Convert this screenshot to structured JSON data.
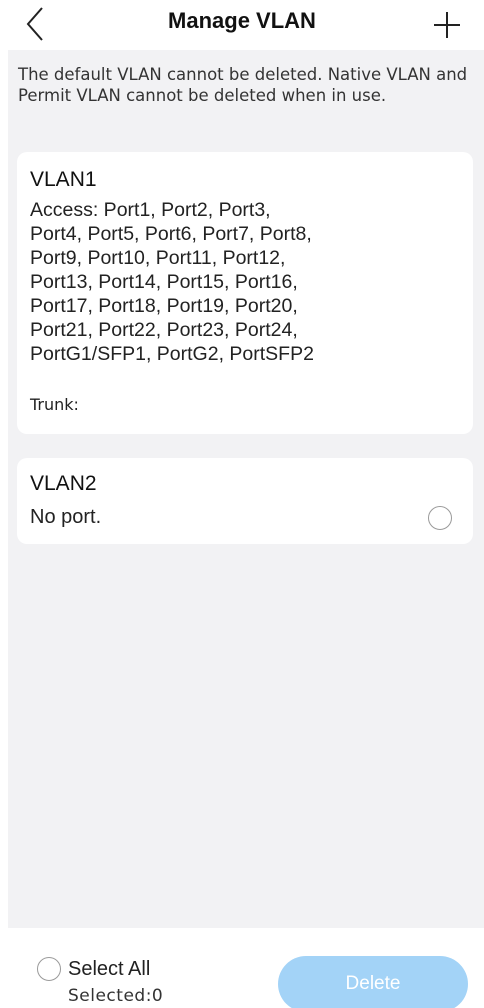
{
  "header": {
    "title": "Manage VLAN"
  },
  "notice": "The default VLAN cannot be deleted. Native VLAN and Permit VLAN cannot be deleted when in use.",
  "vlans": [
    {
      "name": "VLAN1",
      "ports_lines": [
        "Access: Port1, Port2, Port3,",
        "Port4, Port5, Port6, Port7, Port8,",
        "Port9, Port10, Port11, Port12,",
        "Port13, Port14, Port15, Port16,",
        "Port17, Port18, Port19, Port20,",
        "Port21, Port22, Port23, Port24,",
        "PortG1/SFP1, PortG2, PortSFP2"
      ],
      "trunk": "Trunk:"
    },
    {
      "name": "VLAN2",
      "ports": "No port."
    }
  ],
  "footer": {
    "select_all_label": "Select All",
    "selected_count": "Selected:0",
    "delete_label": "Delete"
  },
  "colors": {
    "background": "#f2f2f4",
    "delete_button": "#a3d3f7"
  },
  "icons": {
    "back": "chevron-left-icon",
    "add": "plus-icon"
  }
}
